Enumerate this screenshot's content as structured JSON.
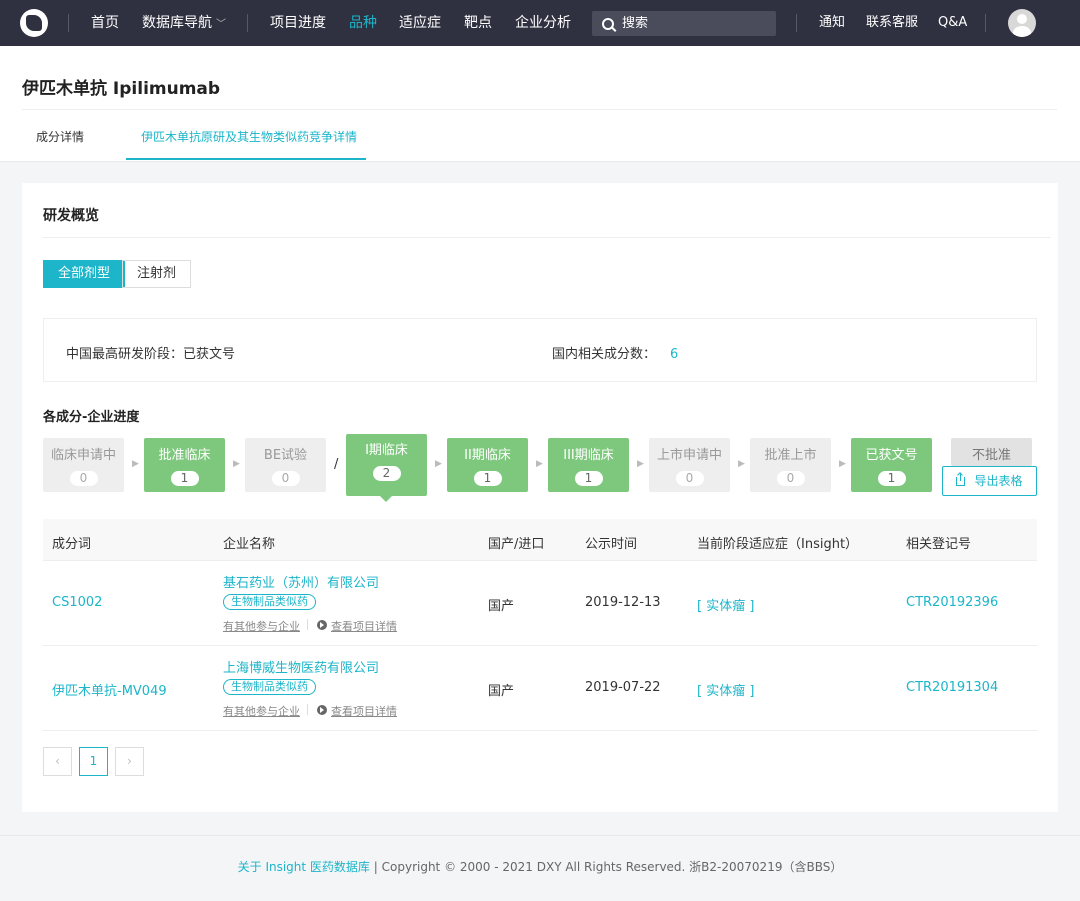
{
  "nav": {
    "items": [
      {
        "label": "首页"
      },
      {
        "label": "数据库导航"
      },
      {
        "label": "项目进度"
      },
      {
        "label": "品种"
      },
      {
        "label": "适应症"
      },
      {
        "label": "靶点"
      },
      {
        "label": "企业分析"
      }
    ],
    "search_placeholder": "搜索",
    "right": {
      "notify": "通知",
      "service": "联系客服",
      "qa": "Q&A"
    },
    "accent": "#1cb5c9",
    "bg": "#2f3140"
  },
  "header": {
    "title": "伊匹木单抗 Ipilimumab",
    "tabs": [
      {
        "label": "成分详情"
      },
      {
        "label": "伊匹木单抗原研及其生物类似药竞争详情"
      }
    ]
  },
  "overview": {
    "title": "研发概览",
    "segments": [
      {
        "label": "全部剂型"
      },
      {
        "label": "注射剂"
      }
    ],
    "highest_stage_label": "中国最高研发阶段：已获文号",
    "related_count_label": "国内相关成分数：",
    "related_count_value": "6",
    "progress_title": "各成分-企业进度",
    "stages": [
      {
        "label": "临床申请中",
        "count": "0",
        "status": "gray"
      },
      {
        "label": "批准临床",
        "count": "1",
        "status": "green"
      },
      {
        "label": "BE试验",
        "count": "0",
        "status": "gray"
      },
      {
        "label": "I期临床",
        "count": "2",
        "status": "green-selected"
      },
      {
        "label": "II期临床",
        "count": "1",
        "status": "green"
      },
      {
        "label": "III期临床",
        "count": "1",
        "status": "green"
      },
      {
        "label": "上市申请中",
        "count": "0",
        "status": "gray"
      },
      {
        "label": "批准上市",
        "count": "0",
        "status": "gray"
      },
      {
        "label": "已获文号",
        "count": "1",
        "status": "green"
      },
      {
        "label": "不批准",
        "status": "gray"
      }
    ],
    "slash": "/",
    "export_label": "导出表格"
  },
  "table": {
    "headers": [
      "成分词",
      "企业名称",
      "国产/进口",
      "公示时间",
      "当前阶段适应症（Insight）",
      "相关登记号"
    ],
    "rows": [
      {
        "ingredient": "CS1002",
        "company": "基石药业（苏州）有限公司",
        "tag": "生物制品类似药",
        "other_link": "有其他参与企业",
        "detail_link": "查看项目详情",
        "origin": "国产",
        "date": "2019-12-13",
        "indication": "[ 实体瘤 ]",
        "reg_no": "CTR20192396"
      },
      {
        "ingredient": "伊匹木单抗-MV049",
        "company": "上海博威生物医药有限公司",
        "tag": "生物制品类似药",
        "other_link": "有其他参与企业",
        "detail_link": "查看项目详情",
        "origin": "国产",
        "date": "2019-07-22",
        "indication": "[ 实体瘤 ]",
        "reg_no": "CTR20191304"
      }
    ]
  },
  "pagination": {
    "prev": "‹",
    "current": "1",
    "next": "›"
  },
  "footer": {
    "link": "关于 Insight 医药数据库",
    "text": "| Copyright © 2000 - 2021 DXY All Rights Reserved. 浙B2-20070219（含BBS）"
  }
}
